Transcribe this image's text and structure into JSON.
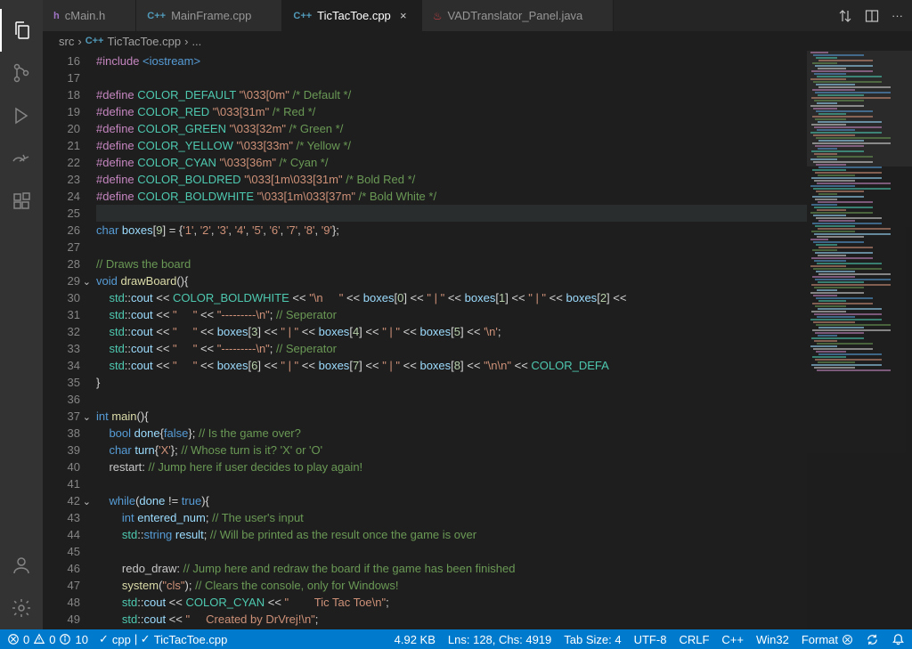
{
  "tabs": [
    {
      "icon": "h",
      "label": "cMain.h"
    },
    {
      "icon": "cpp",
      "label": "MainFrame.cpp"
    },
    {
      "icon": "cpp",
      "label": "TicTacToe.cpp",
      "active": true
    },
    {
      "icon": "java",
      "label": "VADTranslator_Panel.java"
    }
  ],
  "breadcrumb": {
    "seg1": "src",
    "seg2": "TicTacToe.cpp",
    "seg3": "..."
  },
  "lines": {
    "start": 16,
    "end": 49,
    "16": [
      [
        "pre",
        "#include "
      ],
      [
        "def",
        "<iostream>"
      ]
    ],
    "17": [],
    "18": [
      [
        "pre",
        "#define "
      ],
      [
        "mac",
        "COLOR_DEFAULT "
      ],
      [
        "str",
        "\"\\033[0m\""
      ],
      [
        "cmt",
        " /* Default */"
      ]
    ],
    "19": [
      [
        "pre",
        "#define "
      ],
      [
        "mac",
        "COLOR_RED "
      ],
      [
        "str",
        "\"\\033[31m\""
      ],
      [
        "cmt",
        " /* Red */"
      ]
    ],
    "20": [
      [
        "pre",
        "#define "
      ],
      [
        "mac",
        "COLOR_GREEN "
      ],
      [
        "str",
        "\"\\033[32m\""
      ],
      [
        "cmt",
        " /* Green */"
      ]
    ],
    "21": [
      [
        "pre",
        "#define "
      ],
      [
        "mac",
        "COLOR_YELLOW "
      ],
      [
        "str",
        "\"\\033[33m\""
      ],
      [
        "cmt",
        " /* Yellow */"
      ]
    ],
    "22": [
      [
        "pre",
        "#define "
      ],
      [
        "mac",
        "COLOR_CYAN "
      ],
      [
        "str",
        "\"\\033[36m\""
      ],
      [
        "cmt",
        " /* Cyan */"
      ]
    ],
    "23": [
      [
        "pre",
        "#define "
      ],
      [
        "mac",
        "COLOR_BOLDRED "
      ],
      [
        "str",
        "\"\\033[1m\\033[31m\""
      ],
      [
        "cmt",
        " /* Bold Red */"
      ]
    ],
    "24": [
      [
        "pre",
        "#define "
      ],
      [
        "mac",
        "COLOR_BOLDWHITE "
      ],
      [
        "str",
        "\"\\033[1m\\033[37m\""
      ],
      [
        "cmt",
        " /* Bold White */"
      ]
    ],
    "25": [],
    "26": [
      [
        "kw",
        "char "
      ],
      [
        "var",
        "boxes"
      ],
      [
        "",
        "["
      ],
      [
        "num",
        "9"
      ],
      [
        "",
        "] = {"
      ],
      [
        "str",
        "'1'"
      ],
      [
        "",
        ", "
      ],
      [
        "str",
        "'2'"
      ],
      [
        "",
        ", "
      ],
      [
        "str",
        "'3'"
      ],
      [
        "",
        ", "
      ],
      [
        "str",
        "'4'"
      ],
      [
        "",
        ", "
      ],
      [
        "str",
        "'5'"
      ],
      [
        "",
        ", "
      ],
      [
        "str",
        "'6'"
      ],
      [
        "",
        ", "
      ],
      [
        "str",
        "'7'"
      ],
      [
        "",
        ", "
      ],
      [
        "str",
        "'8'"
      ],
      [
        "",
        ", "
      ],
      [
        "str",
        "'9'"
      ],
      [
        "",
        "};"
      ]
    ],
    "27": [],
    "28": [
      [
        "cmt",
        "// Draws the board"
      ]
    ],
    "29": [
      [
        "kw",
        "void "
      ],
      [
        "fn",
        "drawBoard"
      ],
      [
        "",
        "(){"
      ]
    ],
    "30": [
      [
        "",
        "    "
      ],
      [
        "ns",
        "std"
      ],
      [
        "",
        "::"
      ],
      [
        "var",
        "cout"
      ],
      [
        "",
        ""
      ],
      [
        "",
        " << "
      ],
      [
        "mac",
        "COLOR_BOLDWHITE"
      ],
      [
        "",
        " << "
      ],
      [
        "str",
        "\"\\n     \""
      ],
      [
        "",
        " << "
      ],
      [
        "var",
        "boxes"
      ],
      [
        "",
        "["
      ],
      [
        "num",
        "0"
      ],
      [
        "",
        "] << "
      ],
      [
        "str",
        "\" | \""
      ],
      [
        "",
        " << "
      ],
      [
        "var",
        "boxes"
      ],
      [
        "",
        "["
      ],
      [
        "num",
        "1"
      ],
      [
        "",
        "] << "
      ],
      [
        "str",
        "\" | \""
      ],
      [
        "",
        " << "
      ],
      [
        "var",
        "boxes"
      ],
      [
        "",
        "["
      ],
      [
        "num",
        "2"
      ],
      [
        "",
        "] <<"
      ]
    ],
    "31": [
      [
        "",
        "    "
      ],
      [
        "ns",
        "std"
      ],
      [
        "",
        "::"
      ],
      [
        "var",
        "cout"
      ],
      [
        "",
        " << "
      ],
      [
        "str",
        "\"     \""
      ],
      [
        "",
        " << "
      ],
      [
        "str",
        "\"---------\\n\""
      ],
      [
        "",
        "; "
      ],
      [
        "cmt",
        "// Seperator"
      ]
    ],
    "32": [
      [
        "",
        "    "
      ],
      [
        "ns",
        "std"
      ],
      [
        "",
        "::"
      ],
      [
        "var",
        "cout"
      ],
      [
        "",
        " << "
      ],
      [
        "str",
        "\"     \""
      ],
      [
        "",
        " << "
      ],
      [
        "var",
        "boxes"
      ],
      [
        "",
        "["
      ],
      [
        "num",
        "3"
      ],
      [
        "",
        "] << "
      ],
      [
        "str",
        "\" | \""
      ],
      [
        "",
        " << "
      ],
      [
        "var",
        "boxes"
      ],
      [
        "",
        "["
      ],
      [
        "num",
        "4"
      ],
      [
        "",
        "] << "
      ],
      [
        "str",
        "\" | \""
      ],
      [
        "",
        " << "
      ],
      [
        "var",
        "boxes"
      ],
      [
        "",
        "["
      ],
      [
        "num",
        "5"
      ],
      [
        "",
        "] << "
      ],
      [
        "str",
        "'\\n'"
      ],
      [
        "",
        ";"
      ]
    ],
    "33": [
      [
        "",
        "    "
      ],
      [
        "ns",
        "std"
      ],
      [
        "",
        "::"
      ],
      [
        "var",
        "cout"
      ],
      [
        "",
        " << "
      ],
      [
        "str",
        "\"     \""
      ],
      [
        "",
        " << "
      ],
      [
        "str",
        "\"---------\\n\""
      ],
      [
        "",
        "; "
      ],
      [
        "cmt",
        "// Seperator"
      ]
    ],
    "34": [
      [
        "",
        "    "
      ],
      [
        "ns",
        "std"
      ],
      [
        "",
        "::"
      ],
      [
        "var",
        "cout"
      ],
      [
        "",
        " << "
      ],
      [
        "str",
        "\"     \""
      ],
      [
        "",
        " << "
      ],
      [
        "var",
        "boxes"
      ],
      [
        "",
        "["
      ],
      [
        "num",
        "6"
      ],
      [
        "",
        "] << "
      ],
      [
        "str",
        "\" | \""
      ],
      [
        "",
        " << "
      ],
      [
        "var",
        "boxes"
      ],
      [
        "",
        "["
      ],
      [
        "num",
        "7"
      ],
      [
        "",
        "] << "
      ],
      [
        "str",
        "\" | \""
      ],
      [
        "",
        " << "
      ],
      [
        "var",
        "boxes"
      ],
      [
        "",
        "["
      ],
      [
        "num",
        "8"
      ],
      [
        "",
        "] << "
      ],
      [
        "str",
        "\"\\n\\n\""
      ],
      [
        "",
        " << "
      ],
      [
        "mac",
        "COLOR_DEFA"
      ]
    ],
    "35": [
      [
        "",
        "}"
      ]
    ],
    "36": [],
    "37": [
      [
        "kw",
        "int "
      ],
      [
        "fn",
        "main"
      ],
      [
        "",
        "(){"
      ]
    ],
    "38": [
      [
        "",
        "    "
      ],
      [
        "kw",
        "bool "
      ],
      [
        "var",
        "done"
      ],
      [
        "",
        "{"
      ],
      [
        "kw",
        "false"
      ],
      [
        "",
        "}; "
      ],
      [
        "cmt",
        "// Is the game over?"
      ]
    ],
    "39": [
      [
        "",
        "    "
      ],
      [
        "kw",
        "char "
      ],
      [
        "var",
        "turn"
      ],
      [
        "",
        "{"
      ],
      [
        "str",
        "'X'"
      ],
      [
        "",
        "}; "
      ],
      [
        "cmt",
        "// Whose turn is it? 'X' or 'O'"
      ]
    ],
    "40": [
      [
        "",
        "    "
      ],
      [
        "lbl",
        "restart"
      ],
      [
        "",
        ": "
      ],
      [
        "cmt",
        "// Jump here if user decides to play again!"
      ]
    ],
    "41": [],
    "42": [
      [
        "",
        "    "
      ],
      [
        "kw",
        "while"
      ],
      [
        "",
        "("
      ],
      [
        "var",
        "done"
      ],
      [
        "",
        " != "
      ],
      [
        "kw",
        "true"
      ],
      [
        "",
        "){"
      ]
    ],
    "43": [
      [
        "",
        "        "
      ],
      [
        "kw",
        "int "
      ],
      [
        "var",
        "entered_num"
      ],
      [
        "",
        "; "
      ],
      [
        "cmt",
        "// The user's input"
      ]
    ],
    "44": [
      [
        "",
        "        "
      ],
      [
        "ns",
        "std"
      ],
      [
        "",
        "::"
      ],
      [
        "ty",
        "string "
      ],
      [
        "var",
        "result"
      ],
      [
        "",
        "; "
      ],
      [
        "cmt",
        "// Will be printed as the result once the game is over"
      ]
    ],
    "45": [],
    "46": [
      [
        "",
        "        "
      ],
      [
        "lbl",
        "redo_draw"
      ],
      [
        "",
        ": "
      ],
      [
        "cmt",
        "// Jump here and redraw the board if the game has been finished"
      ]
    ],
    "47": [
      [
        "",
        "        "
      ],
      [
        "fn",
        "system"
      ],
      [
        "",
        "("
      ],
      [
        "str",
        "\"cls\""
      ],
      [
        "",
        "); "
      ],
      [
        "cmt",
        "// Clears the console, only for Windows!"
      ]
    ],
    "48": [
      [
        "",
        "        "
      ],
      [
        "ns",
        "std"
      ],
      [
        "",
        "::"
      ],
      [
        "var",
        "cout"
      ],
      [
        "",
        " << "
      ],
      [
        "mac",
        "COLOR_CYAN"
      ],
      [
        "",
        " << "
      ],
      [
        "str",
        "\"        Tic Tac Toe\\n\""
      ],
      [
        "",
        ";"
      ]
    ],
    "49": [
      [
        "",
        "        "
      ],
      [
        "ns",
        "std"
      ],
      [
        "",
        "::"
      ],
      [
        "var",
        "cout"
      ],
      [
        "",
        " << "
      ],
      [
        "str",
        "\"     Created by DrVrej!\\n\""
      ],
      [
        "",
        ";"
      ]
    ]
  },
  "folds": {
    "29": true,
    "37": true,
    "42": true
  },
  "highlightLine": 25,
  "status": {
    "errors": "0",
    "warnings": "0",
    "info": "10",
    "lang_mode": "cpp",
    "active_file": "TicTacToe.cpp",
    "size": "4.92 KB",
    "lines_chars": "Lns: 128, Chs: 4919",
    "tabsize": "Tab Size: 4",
    "encoding": "UTF-8",
    "eol": "CRLF",
    "language": "C++",
    "platform": "Win32",
    "format": "Format"
  }
}
